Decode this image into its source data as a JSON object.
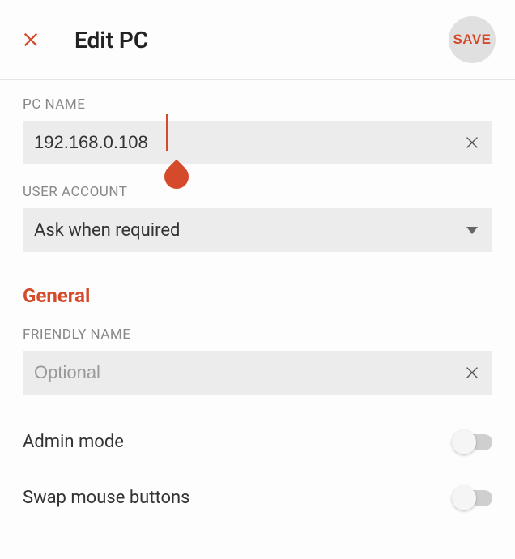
{
  "header": {
    "title": "Edit PC",
    "save_label": "SAVE"
  },
  "fields": {
    "pc_name": {
      "label": "PC NAME",
      "value": "192.168.0.108"
    },
    "user_account": {
      "label": "USER ACCOUNT",
      "value": "Ask when required"
    }
  },
  "general": {
    "section_title": "General",
    "friendly_name": {
      "label": "FRIENDLY NAME",
      "placeholder": "Optional",
      "value": ""
    },
    "admin_mode": {
      "label": "Admin mode",
      "enabled": false
    },
    "swap_mouse": {
      "label": "Swap mouse buttons",
      "enabled": false
    }
  }
}
